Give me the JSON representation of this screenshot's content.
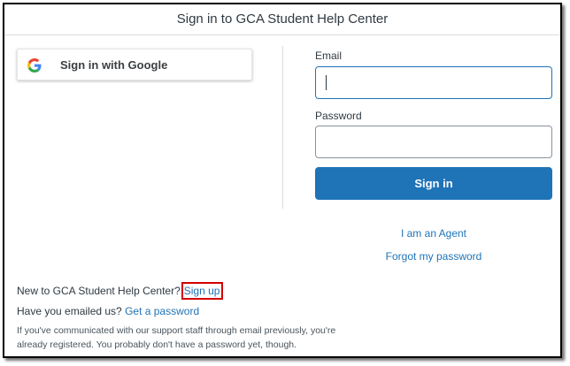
{
  "header": {
    "title": "Sign in to GCA Student Help Center"
  },
  "google": {
    "label": "Sign in with Google",
    "icon": "google-icon"
  },
  "form": {
    "email_label": "Email",
    "email_value": "",
    "password_label": "Password",
    "password_value": "",
    "submit_label": "Sign in"
  },
  "links": {
    "agent": "I am an Agent",
    "forgot": "Forgot my password"
  },
  "footer": {
    "new_to": "New to GCA Student Help Center?",
    "sign_up": "Sign up",
    "emailed": "Have you emailed us?",
    "get_password": "Get a password",
    "note": "If you've communicated with our support staff through email previously, you're already registered. You probably don't have a password yet, though."
  },
  "colors": {
    "accent": "#1f73b7",
    "highlight_box": "#d40000"
  }
}
